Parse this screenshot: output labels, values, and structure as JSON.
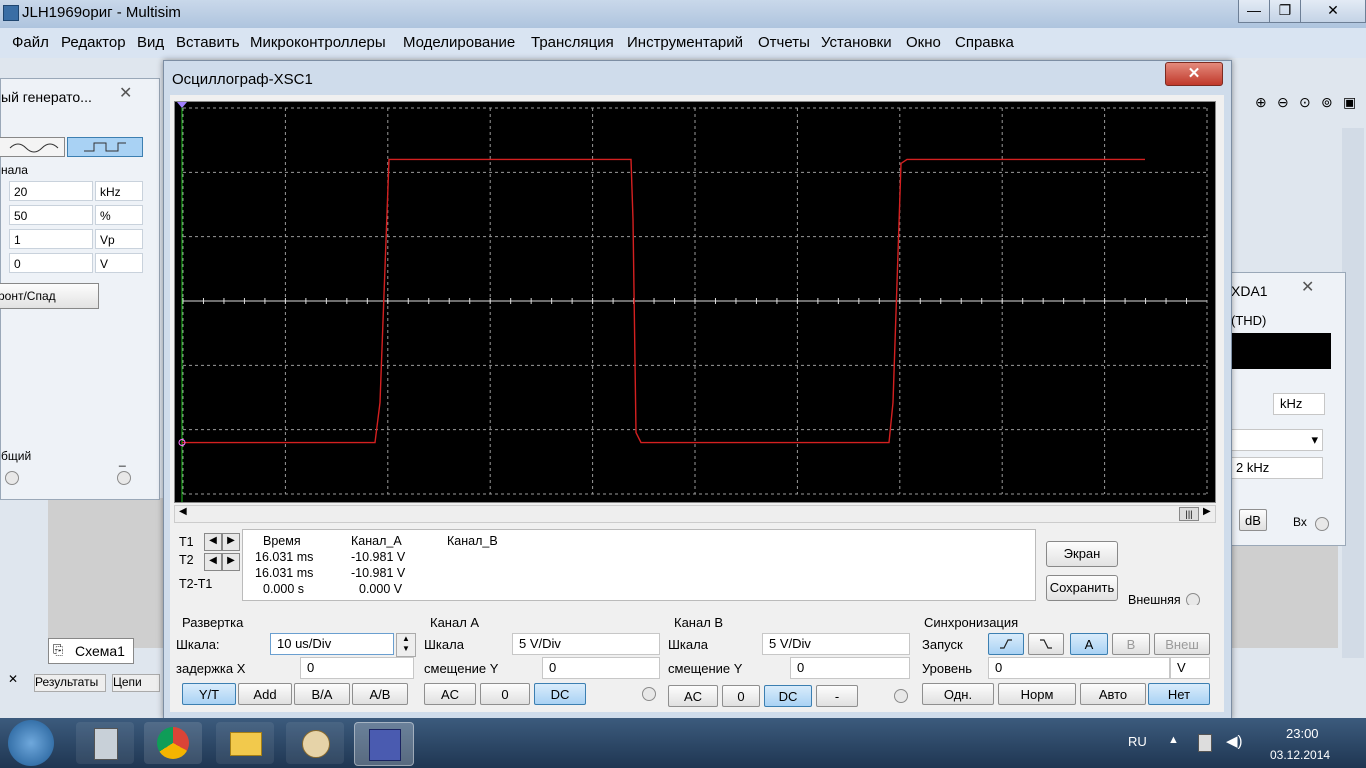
{
  "app": {
    "title": "JLH1969ориг - Multisim",
    "win_min": "—",
    "win_max": "❐",
    "win_close": "✕"
  },
  "menu": [
    "Файл",
    "Редактор",
    "Вид",
    "Вставить",
    "Микроконтроллеры",
    "Моделирование",
    "Трансляция",
    "Инструментарий",
    "Отчеты",
    "Установки",
    "Окно",
    "Справка"
  ],
  "fgen": {
    "title": "ый генерато...",
    "close": "✕",
    "section": "нала",
    "fields": [
      {
        "value": "20",
        "unit": "kHz"
      },
      {
        "value": "50",
        "unit": "%"
      },
      {
        "value": "1",
        "unit": "Vp"
      },
      {
        "value": "0",
        "unit": "V"
      }
    ],
    "edge_btn": "ронт/Спад",
    "common_label": "бщий",
    "minus_label": "_"
  },
  "scope": {
    "title": "Осциллограф-XSC1",
    "close": "✕",
    "screen": {
      "grid_cols": 10,
      "grid_rows": 6,
      "trace_color": "#d42020"
    },
    "readout": {
      "headers": {
        "time": "Время",
        "a": "Канал_A",
        "b": "Канал_B"
      },
      "rows": [
        {
          "label": "T1",
          "time": "16.031 ms",
          "a": "-10.981 V"
        },
        {
          "label": "T2",
          "time": "16.031 ms",
          "a": "-10.981 V"
        },
        {
          "label": "T2-T1",
          "time": "0.000 s",
          "a": "0.000 V"
        }
      ]
    },
    "buttons": {
      "screen": "Экран",
      "save": "Сохранить",
      "external": "Внешняя"
    },
    "timebase": {
      "title": "Развертка",
      "scale_label": "Шкала:",
      "scale": "10 us/Div",
      "xpos_label": "задержка X",
      "xpos": "0",
      "modes": [
        "Y/T",
        "Add",
        "B/A",
        "A/B"
      ]
    },
    "channel_a": {
      "title": "Канал A",
      "scale_label": "Шкала",
      "scale": "5  V/Div",
      "ypos_label": "смещение Y",
      "ypos": "0",
      "coupling": [
        "AC",
        "0",
        "DC"
      ]
    },
    "channel_b": {
      "title": "Канал B",
      "scale_label": "Шкала",
      "scale": "5  V/Div",
      "ypos_label": "смещение Y",
      "ypos": "0",
      "coupling": [
        "AC",
        "0",
        "DC",
        "-"
      ]
    },
    "trigger": {
      "title": "Синхронизация",
      "edge_label": "Запуск",
      "sources": [
        "A",
        "B",
        "Внеш"
      ],
      "level_label": "Уровень",
      "level": "0",
      "level_unit": "V",
      "modes": [
        "Одн.",
        "Норм",
        "Авто",
        "Нет"
      ]
    }
  },
  "dist": {
    "title": "XDA1",
    "close": "✕",
    "thd": "(THD)",
    "unit_khz": "kHz",
    "freq": "2 kHz",
    "db": "dB",
    "in": "Вх"
  },
  "bottom_tabs": {
    "schema": "Схема1",
    "results": "Результаты",
    "nets": "Цепи"
  },
  "tray": {
    "lang": "RU",
    "time": "23:00",
    "date": "03.12.2014"
  }
}
